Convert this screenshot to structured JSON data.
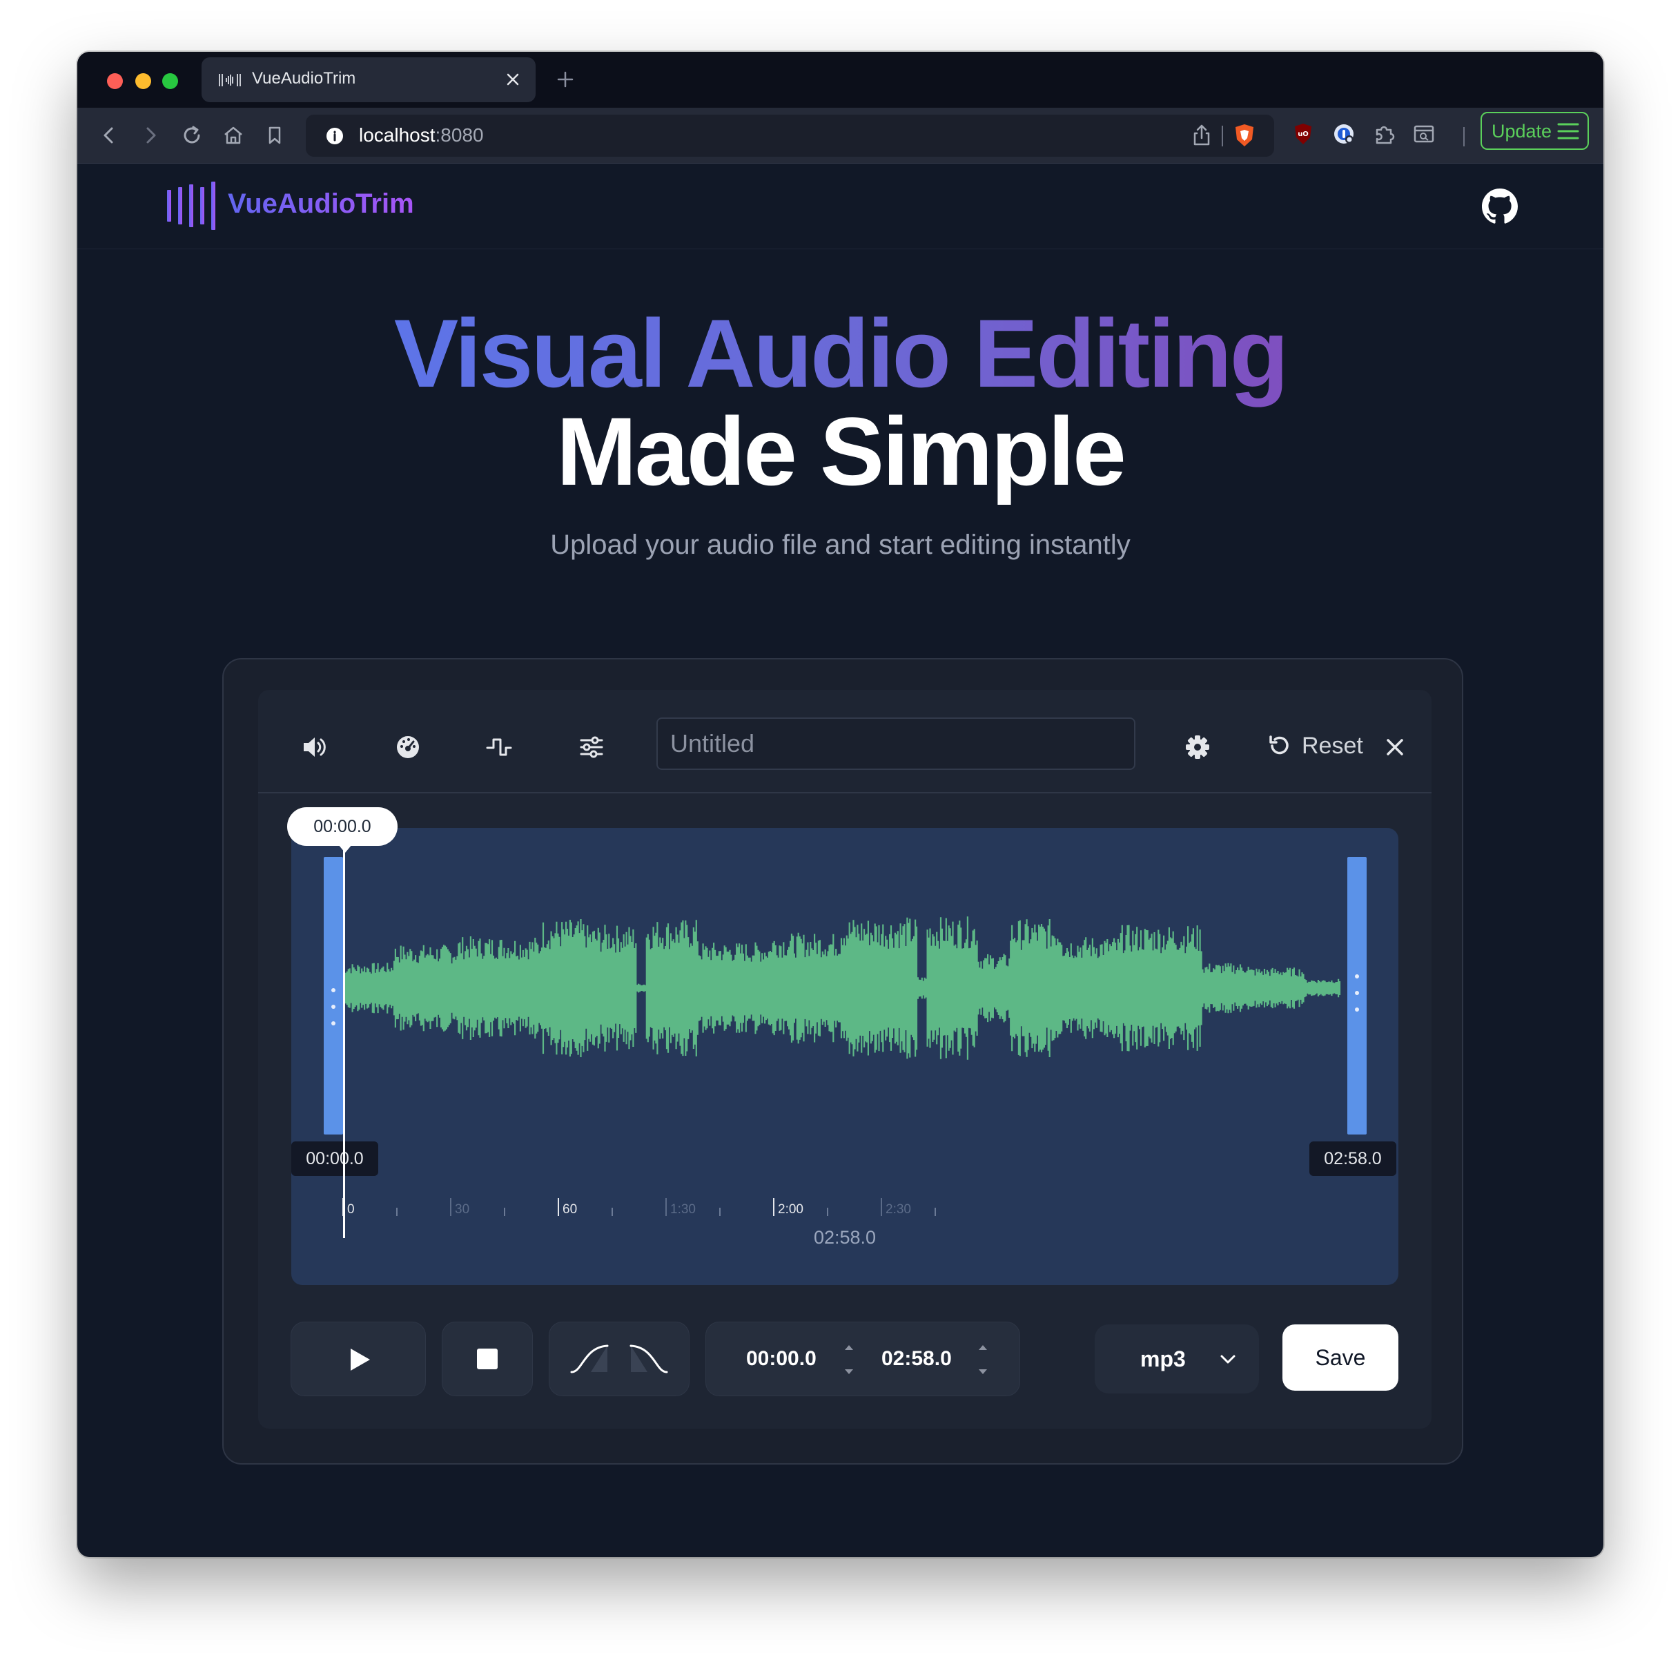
{
  "browser": {
    "tab_title": "VueAudioTrim",
    "url_host": "localhost",
    "url_port": ":8080",
    "update_label": "Update"
  },
  "app": {
    "logo_text": "VueAudioTrim",
    "accent_start": "#6366f1",
    "accent_end": "#a855f7"
  },
  "hero": {
    "title_gradient": "Visual Audio Editing",
    "title_plain": "Made Simple",
    "subtitle": "Upload your audio file and start editing instantly"
  },
  "editor": {
    "title_placeholder": "Untitled",
    "reset_label": "Reset",
    "playhead_time": "00:00.0",
    "start_label": "00:00.0",
    "end_label": "02:58.0",
    "duration": "02:58.0",
    "ruler_ticks": [
      "0",
      "30",
      "60",
      "1:30",
      "2:00",
      "2:30"
    ],
    "start_time": "00:00.0",
    "end_time": "02:58.0",
    "format": "mp3",
    "save_label": "Save",
    "waveform_color": "#5db886",
    "selection_color": "#5b92e8"
  }
}
